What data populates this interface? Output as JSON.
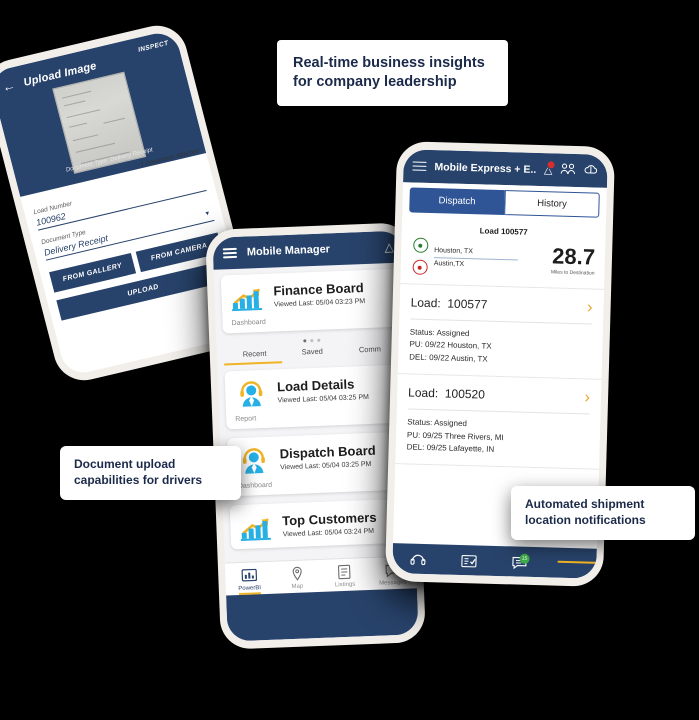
{
  "theme": {
    "background": "#000000",
    "navy": "#28436b",
    "accent_yellow": "#f0b323",
    "cyan": "#27b0e6",
    "tab_blue": "#2f5597",
    "green": "#3fae49",
    "red": "#c62828"
  },
  "callouts": [
    {
      "id": "insights",
      "text": "Real-time business insights for company leadership"
    },
    {
      "id": "upload",
      "text": "Document upload capabilities for drivers"
    },
    {
      "id": "notify",
      "text": "Automated shipment location notifications"
    }
  ],
  "upload_phone": {
    "header": {
      "back_icon": "back-arrow-icon",
      "title": "Upload Image",
      "inspect_label": "INSPECT"
    },
    "preview": {
      "caption": "Document Type: Delivery Receipt",
      "attached_count": "1 Documents Attached"
    },
    "fields": [
      {
        "label": "Load Number",
        "value": "100962"
      },
      {
        "label": "Document Type",
        "value": "Delivery Receipt"
      }
    ],
    "buttons": {
      "gallery": "FROM GALLERY",
      "camera": "FROM CAMERA",
      "upload": "UPLOAD"
    }
  },
  "manager_phone": {
    "header": {
      "menu_icon": "hamburger-icon",
      "title": "Mobile Manager",
      "warning_icon": "warning-triangle-icon"
    },
    "cards": [
      {
        "title": "Finance Board",
        "subtitle": "Viewed Last: 05/04 03:23 PM",
        "tag": "Dashboard",
        "icon": "bar-chart-icon"
      },
      {
        "title": "Load Details",
        "subtitle": "Viewed Last: 05/04 03:25 PM",
        "tag": "Report",
        "icon": "agent-headset-icon"
      },
      {
        "title": "Dispatch Board",
        "subtitle": "Viewed Last: 05/04 03:25 PM",
        "tag": "Dashboard",
        "icon": "agent-headset-icon"
      },
      {
        "title": "Top Customers",
        "subtitle": "Viewed Last: 05/04 03:24 PM",
        "tag": "",
        "icon": "bar-chart-icon"
      }
    ],
    "tabs": [
      {
        "label": "Recent",
        "active": true
      },
      {
        "label": "Saved",
        "active": false
      },
      {
        "label": "Comm",
        "active": false
      }
    ],
    "nav": [
      {
        "label": "PowerBI",
        "icon": "powerbi-icon",
        "active": true
      },
      {
        "label": "Map",
        "icon": "map-icon",
        "active": false
      },
      {
        "label": "Listings",
        "icon": "listings-icon",
        "active": false
      },
      {
        "label": "Messages",
        "icon": "messages-icon",
        "active": false
      }
    ]
  },
  "express_phone": {
    "header": {
      "menu_icon": "hamburger-icon",
      "title": "Mobile Express + E...",
      "icons": [
        "alert-triangle-icon",
        "people-icon",
        "cloud-icon"
      ]
    },
    "tabs": [
      {
        "label": "Dispatch",
        "active": true
      },
      {
        "label": "History",
        "active": false
      }
    ],
    "route": {
      "heading": "Load 100577",
      "origin": "Houston, TX",
      "destination": "Austin,TX",
      "miles_value": "28.7",
      "miles_caption": "Miles to Destination"
    },
    "loads": [
      {
        "label": "Load:",
        "number": "100577",
        "status_line": "Status:  Assigned",
        "pickup_line": "PU: 09/22 Houston, TX",
        "delivery_line": "DEL: 09/22 Austin, TX",
        "chevron": "chevron-right-icon"
      },
      {
        "label": "Load:",
        "number": "100520",
        "status_line": "Status:  Assigned",
        "pickup_line": "PU: 09/25 Three Rivers, MI",
        "delivery_line": "DEL: 09/25 Lafayette, IN",
        "chevron": "chevron-right-icon"
      }
    ],
    "nav": [
      {
        "icon": "headset-icon",
        "badge": ""
      },
      {
        "icon": "document-check-icon",
        "badge": ""
      },
      {
        "icon": "chat-icon",
        "badge": "15"
      }
    ]
  }
}
